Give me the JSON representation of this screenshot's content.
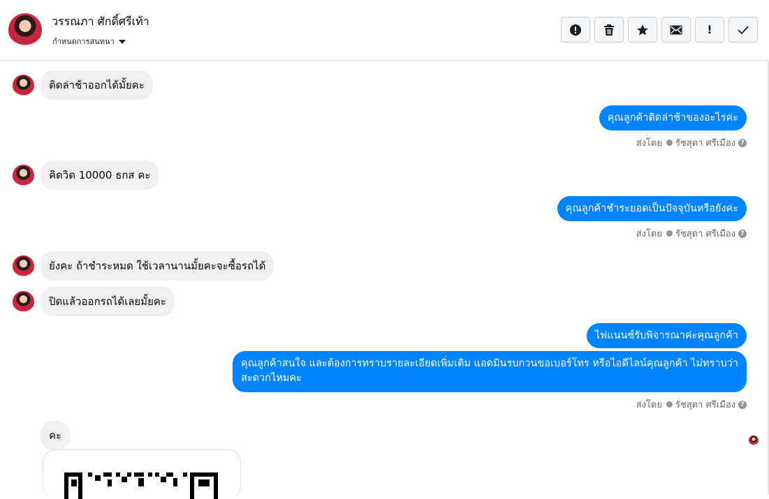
{
  "header": {
    "contact_name": "วรรณภา ศักดิ์ศรีเท้า",
    "assign_label": "กำหนดการสนทนา",
    "toolbar": [
      {
        "name": "report-spam-button",
        "icon": "alert-circle-icon"
      },
      {
        "name": "delete-button",
        "icon": "trash-icon"
      },
      {
        "name": "star-button",
        "icon": "star-icon"
      },
      {
        "name": "mark-unread-button",
        "icon": "envelope-icon"
      },
      {
        "name": "follow-up-button",
        "icon": "exclamation-icon",
        "glyph": "!"
      },
      {
        "name": "mark-done-button",
        "icon": "check-icon"
      }
    ]
  },
  "messages": [
    {
      "dir": "in",
      "text": "ติดล่าช้าออกได้มั้ยคะ"
    },
    {
      "dir": "out",
      "text": "คุณลูกค้าติดล่าช้าของอะไรค่ะ"
    },
    {
      "dir": "in",
      "text": "คิดวิด 10000 ธกส คะ"
    },
    {
      "dir": "out",
      "text": "คุณลูกค้าชำระยอดเป็นปัจจุบันหรือยังค่ะ"
    },
    {
      "dir": "in",
      "text": "ยังคะ ถ้าชำระหมด ใช้เวลานานมั้ยคะจะซื้อรถได้"
    },
    {
      "dir": "in",
      "text": "ปิดแล้วออกรถได้เลยมั้ยคะ"
    },
    {
      "dir": "out",
      "text": "ไฟแนนซ์รับพิจารณาค่ะคุณลูกค้า"
    },
    {
      "dir": "out",
      "text": "คุณลูกค้าสนใจ และต้องการทราบรายละเอียดเพิ่มเติม แอดมินรบกวนขอเบอร์โทร หรือไอดีไลน์คุณลูกค้า ไม่ทราบว่าสะดวกไหมคะ"
    },
    {
      "dir": "in",
      "text": "คะ"
    }
  ],
  "sent_by": {
    "label": "ส่งโดย",
    "agent": "รัชสุดา ศรีเมือง",
    "help": "?"
  },
  "colors": {
    "outgoing": "#0084ff",
    "incoming": "#f0f0f0"
  }
}
